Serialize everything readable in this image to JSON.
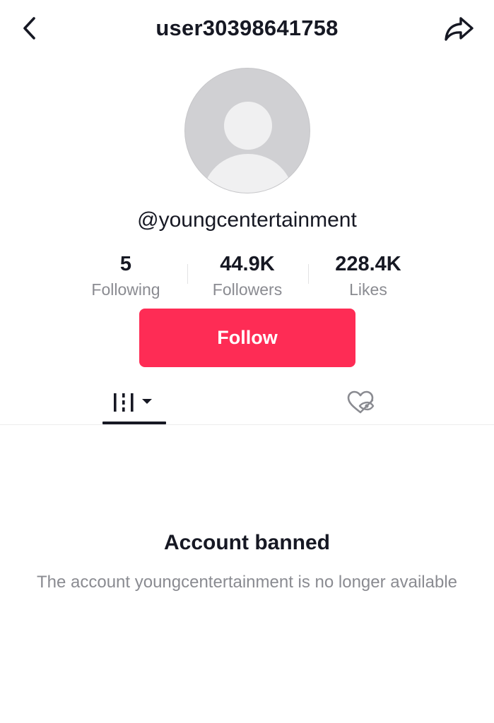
{
  "header": {
    "title": "user30398641758",
    "back_icon": "chevron-left-icon",
    "share_icon": "share-arrow-icon"
  },
  "profile": {
    "avatar_icon": "default-avatar-icon",
    "username": "@youngcentertainment"
  },
  "stats": [
    {
      "value": "5",
      "label": "Following"
    },
    {
      "value": "44.9K",
      "label": "Followers"
    },
    {
      "value": "228.4K",
      "label": "Likes"
    }
  ],
  "actions": {
    "follow_label": "Follow"
  },
  "tabs": [
    {
      "icon": "videos-grid-dropdown-icon",
      "active": true
    },
    {
      "icon": "liked-hidden-heart-icon",
      "active": false
    }
  ],
  "banned": {
    "title": "Account banned",
    "description": "The account youngcentertainment is no longer available"
  },
  "colors": {
    "accent": "#fe2c55",
    "text": "#161823",
    "muted": "#8a8b91",
    "avatar_bg": "#d0d0d3"
  }
}
